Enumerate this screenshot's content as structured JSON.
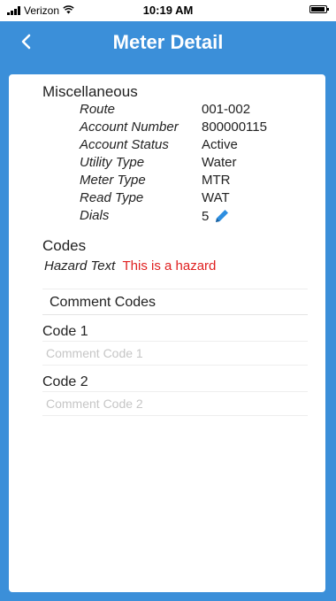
{
  "status_bar": {
    "carrier": "Verizon",
    "time": "10:19 AM"
  },
  "nav": {
    "title": "Meter Detail"
  },
  "miscellaneous": {
    "heading": "Miscellaneous",
    "rows": [
      {
        "label": "Route",
        "value": "001-002"
      },
      {
        "label": "Account Number",
        "value": "800000115"
      },
      {
        "label": "Account Status",
        "value": "Active"
      },
      {
        "label": "Utility Type",
        "value": "Water"
      },
      {
        "label": "Meter Type",
        "value": "MTR"
      },
      {
        "label": "Read Type",
        "value": "WAT"
      },
      {
        "label": "Dials",
        "value": "5"
      }
    ]
  },
  "codes": {
    "heading": "Codes",
    "hazard_label": "Hazard Text",
    "hazard_value": "This is a hazard",
    "comment_codes_label": "Comment Codes",
    "code1_label": "Code 1",
    "code1_placeholder": "Comment Code 1",
    "code1_value": "",
    "code2_label": "Code 2",
    "code2_placeholder": "Comment Code 2",
    "code2_value": ""
  },
  "colors": {
    "nav_background": "#3b8fd9",
    "hazard_text": "#e02020",
    "accent": "#2d8ee0"
  },
  "icons": {
    "back": "chevron-left-icon",
    "edit_dials": "pencil-icon",
    "wifi": "wifi-icon",
    "signal": "signal-icon",
    "battery": "battery-icon"
  }
}
